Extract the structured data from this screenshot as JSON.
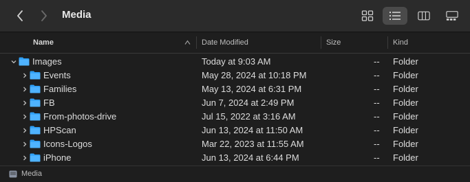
{
  "toolbar": {
    "title": "Media",
    "back_icon": "chevron-left-icon",
    "forward_icon": "chevron-right-icon",
    "views": [
      {
        "icon": "icon-view-icon",
        "active": false
      },
      {
        "icon": "list-view-icon",
        "active": true
      },
      {
        "icon": "column-view-icon",
        "active": false
      },
      {
        "icon": "gallery-view-icon",
        "active": false
      }
    ]
  },
  "columns": {
    "name": "Name",
    "date_modified": "Date Modified",
    "size": "Size",
    "kind": "Kind"
  },
  "rows": [
    {
      "name": "Images",
      "date": "Today at 9:03 AM",
      "size": "--",
      "kind": "Folder",
      "expanded": true,
      "level": 0
    },
    {
      "name": "Events",
      "date": "May 28, 2024 at 10:18 PM",
      "size": "--",
      "kind": "Folder",
      "expanded": false,
      "level": 1
    },
    {
      "name": "Families",
      "date": "May 13, 2024 at 6:31 PM",
      "size": "--",
      "kind": "Folder",
      "expanded": false,
      "level": 1
    },
    {
      "name": "FB",
      "date": "Jun 7, 2024 at 2:49 PM",
      "size": "--",
      "kind": "Folder",
      "expanded": false,
      "level": 1
    },
    {
      "name": "From-photos-drive",
      "date": "Jul 15, 2022 at 3:16 AM",
      "size": "--",
      "kind": "Folder",
      "expanded": false,
      "level": 1
    },
    {
      "name": "HPScan",
      "date": "Jun 13, 2024 at 11:50 AM",
      "size": "--",
      "kind": "Folder",
      "expanded": false,
      "level": 1
    },
    {
      "name": "Icons-Logos",
      "date": "Mar 22, 2023 at 11:55 AM",
      "size": "--",
      "kind": "Folder",
      "expanded": false,
      "level": 1
    },
    {
      "name": "iPhone",
      "date": "Jun 13, 2024 at 6:44 PM",
      "size": "--",
      "kind": "Folder",
      "expanded": false,
      "level": 1
    }
  ],
  "pathbar": {
    "label": "Media",
    "icon": "drive-icon"
  },
  "colors": {
    "folder": "#2f9ff5",
    "background": "#1e1e1e",
    "toolbar": "#2b2b2b"
  }
}
